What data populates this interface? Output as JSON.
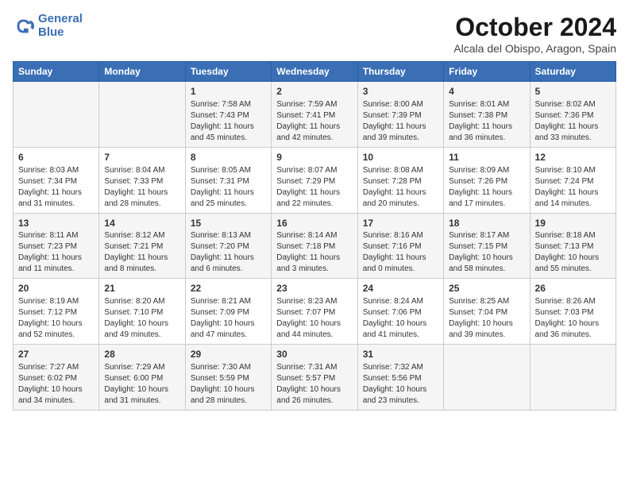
{
  "header": {
    "logo_line1": "General",
    "logo_line2": "Blue",
    "month": "October 2024",
    "location": "Alcala del Obispo, Aragon, Spain"
  },
  "days_of_week": [
    "Sunday",
    "Monday",
    "Tuesday",
    "Wednesday",
    "Thursday",
    "Friday",
    "Saturday"
  ],
  "weeks": [
    [
      {
        "day": "",
        "info": ""
      },
      {
        "day": "",
        "info": ""
      },
      {
        "day": "1",
        "info": "Sunrise: 7:58 AM\nSunset: 7:43 PM\nDaylight: 11 hours\nand 45 minutes."
      },
      {
        "day": "2",
        "info": "Sunrise: 7:59 AM\nSunset: 7:41 PM\nDaylight: 11 hours\nand 42 minutes."
      },
      {
        "day": "3",
        "info": "Sunrise: 8:00 AM\nSunset: 7:39 PM\nDaylight: 11 hours\nand 39 minutes."
      },
      {
        "day": "4",
        "info": "Sunrise: 8:01 AM\nSunset: 7:38 PM\nDaylight: 11 hours\nand 36 minutes."
      },
      {
        "day": "5",
        "info": "Sunrise: 8:02 AM\nSunset: 7:36 PM\nDaylight: 11 hours\nand 33 minutes."
      }
    ],
    [
      {
        "day": "6",
        "info": "Sunrise: 8:03 AM\nSunset: 7:34 PM\nDaylight: 11 hours\nand 31 minutes."
      },
      {
        "day": "7",
        "info": "Sunrise: 8:04 AM\nSunset: 7:33 PM\nDaylight: 11 hours\nand 28 minutes."
      },
      {
        "day": "8",
        "info": "Sunrise: 8:05 AM\nSunset: 7:31 PM\nDaylight: 11 hours\nand 25 minutes."
      },
      {
        "day": "9",
        "info": "Sunrise: 8:07 AM\nSunset: 7:29 PM\nDaylight: 11 hours\nand 22 minutes."
      },
      {
        "day": "10",
        "info": "Sunrise: 8:08 AM\nSunset: 7:28 PM\nDaylight: 11 hours\nand 20 minutes."
      },
      {
        "day": "11",
        "info": "Sunrise: 8:09 AM\nSunset: 7:26 PM\nDaylight: 11 hours\nand 17 minutes."
      },
      {
        "day": "12",
        "info": "Sunrise: 8:10 AM\nSunset: 7:24 PM\nDaylight: 11 hours\nand 14 minutes."
      }
    ],
    [
      {
        "day": "13",
        "info": "Sunrise: 8:11 AM\nSunset: 7:23 PM\nDaylight: 11 hours\nand 11 minutes."
      },
      {
        "day": "14",
        "info": "Sunrise: 8:12 AM\nSunset: 7:21 PM\nDaylight: 11 hours\nand 8 minutes."
      },
      {
        "day": "15",
        "info": "Sunrise: 8:13 AM\nSunset: 7:20 PM\nDaylight: 11 hours\nand 6 minutes."
      },
      {
        "day": "16",
        "info": "Sunrise: 8:14 AM\nSunset: 7:18 PM\nDaylight: 11 hours\nand 3 minutes."
      },
      {
        "day": "17",
        "info": "Sunrise: 8:16 AM\nSunset: 7:16 PM\nDaylight: 11 hours\nand 0 minutes."
      },
      {
        "day": "18",
        "info": "Sunrise: 8:17 AM\nSunset: 7:15 PM\nDaylight: 10 hours\nand 58 minutes."
      },
      {
        "day": "19",
        "info": "Sunrise: 8:18 AM\nSunset: 7:13 PM\nDaylight: 10 hours\nand 55 minutes."
      }
    ],
    [
      {
        "day": "20",
        "info": "Sunrise: 8:19 AM\nSunset: 7:12 PM\nDaylight: 10 hours\nand 52 minutes."
      },
      {
        "day": "21",
        "info": "Sunrise: 8:20 AM\nSunset: 7:10 PM\nDaylight: 10 hours\nand 49 minutes."
      },
      {
        "day": "22",
        "info": "Sunrise: 8:21 AM\nSunset: 7:09 PM\nDaylight: 10 hours\nand 47 minutes."
      },
      {
        "day": "23",
        "info": "Sunrise: 8:23 AM\nSunset: 7:07 PM\nDaylight: 10 hours\nand 44 minutes."
      },
      {
        "day": "24",
        "info": "Sunrise: 8:24 AM\nSunset: 7:06 PM\nDaylight: 10 hours\nand 41 minutes."
      },
      {
        "day": "25",
        "info": "Sunrise: 8:25 AM\nSunset: 7:04 PM\nDaylight: 10 hours\nand 39 minutes."
      },
      {
        "day": "26",
        "info": "Sunrise: 8:26 AM\nSunset: 7:03 PM\nDaylight: 10 hours\nand 36 minutes."
      }
    ],
    [
      {
        "day": "27",
        "info": "Sunrise: 7:27 AM\nSunset: 6:02 PM\nDaylight: 10 hours\nand 34 minutes."
      },
      {
        "day": "28",
        "info": "Sunrise: 7:29 AM\nSunset: 6:00 PM\nDaylight: 10 hours\nand 31 minutes."
      },
      {
        "day": "29",
        "info": "Sunrise: 7:30 AM\nSunset: 5:59 PM\nDaylight: 10 hours\nand 28 minutes."
      },
      {
        "day": "30",
        "info": "Sunrise: 7:31 AM\nSunset: 5:57 PM\nDaylight: 10 hours\nand 26 minutes."
      },
      {
        "day": "31",
        "info": "Sunrise: 7:32 AM\nSunset: 5:56 PM\nDaylight: 10 hours\nand 23 minutes."
      },
      {
        "day": "",
        "info": ""
      },
      {
        "day": "",
        "info": ""
      }
    ]
  ]
}
